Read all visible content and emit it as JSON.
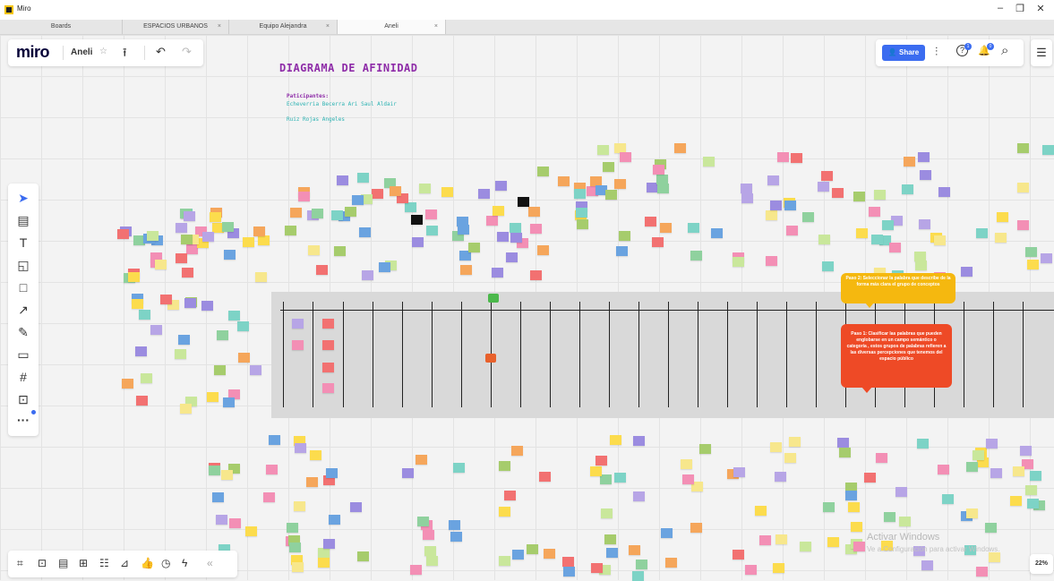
{
  "window": {
    "app_title": "Miro",
    "minimize": "–",
    "restore": "❐",
    "close": "✕"
  },
  "tabs": [
    {
      "label": "Boards"
    },
    {
      "label": "ESPACIOS URBANOS"
    },
    {
      "label": "Equipo Alejandra"
    },
    {
      "label": "Aneli"
    }
  ],
  "tab_close": "×",
  "toolbar": {
    "logo": "miro",
    "board_name": "Aneli",
    "star": "☆",
    "upload": "⭱",
    "undo": "↶",
    "redo": "↷"
  },
  "top_right": {
    "share_label": "Share",
    "share_icon": "👤",
    "settings": "⫶",
    "help": "?",
    "notifications": "🔔",
    "search": "⌕",
    "help_badge": "1",
    "notif_badge": "0",
    "notes": "☰"
  },
  "board": {
    "title": "DIAGRAMA DE AFINIDAD",
    "participants_label": "Paticipantes:",
    "participants": [
      "Echeverria Becerra Ari Saul Aldair",
      "Ruiz  Rojas Angeles"
    ]
  },
  "left_tools": [
    {
      "name": "select",
      "icon": "➤"
    },
    {
      "name": "templates",
      "icon": "▤"
    },
    {
      "name": "text",
      "icon": "T"
    },
    {
      "name": "sticky-note",
      "icon": "◱"
    },
    {
      "name": "shape",
      "icon": "□"
    },
    {
      "name": "arrow",
      "icon": "↗"
    },
    {
      "name": "pen",
      "icon": "✎"
    },
    {
      "name": "comment",
      "icon": "▭"
    },
    {
      "name": "frame",
      "icon": "#"
    },
    {
      "name": "upload",
      "icon": "⊡"
    },
    {
      "name": "more",
      "icon": "···"
    }
  ],
  "bottom_tools": [
    "⌗",
    "⊡",
    "▤",
    "⊞",
    "☷",
    "⊿",
    "👍",
    "◷",
    "ϟ",
    "«"
  ],
  "zoom": "22%",
  "callouts": {
    "step2": "Paso 2: Seleccionar la palabra que describe de la forma más clara el grupo de conceptos",
    "step1": "Paso 1: Clasificar las palabras  que pueden englobarse en un campo semántico o categoría , estos grupos de palabras refieren a las diversas percepciones que tenemos del espacio público"
  },
  "watermark": {
    "title": "Activar Windows",
    "subtitle": "Ve a Configuración para activar Windows."
  },
  "colors": {
    "accent": "#3b6cf0",
    "title_purple": "#8e2ca8",
    "callout_yellow": "#f5b80f",
    "callout_red": "#ee4a26"
  }
}
